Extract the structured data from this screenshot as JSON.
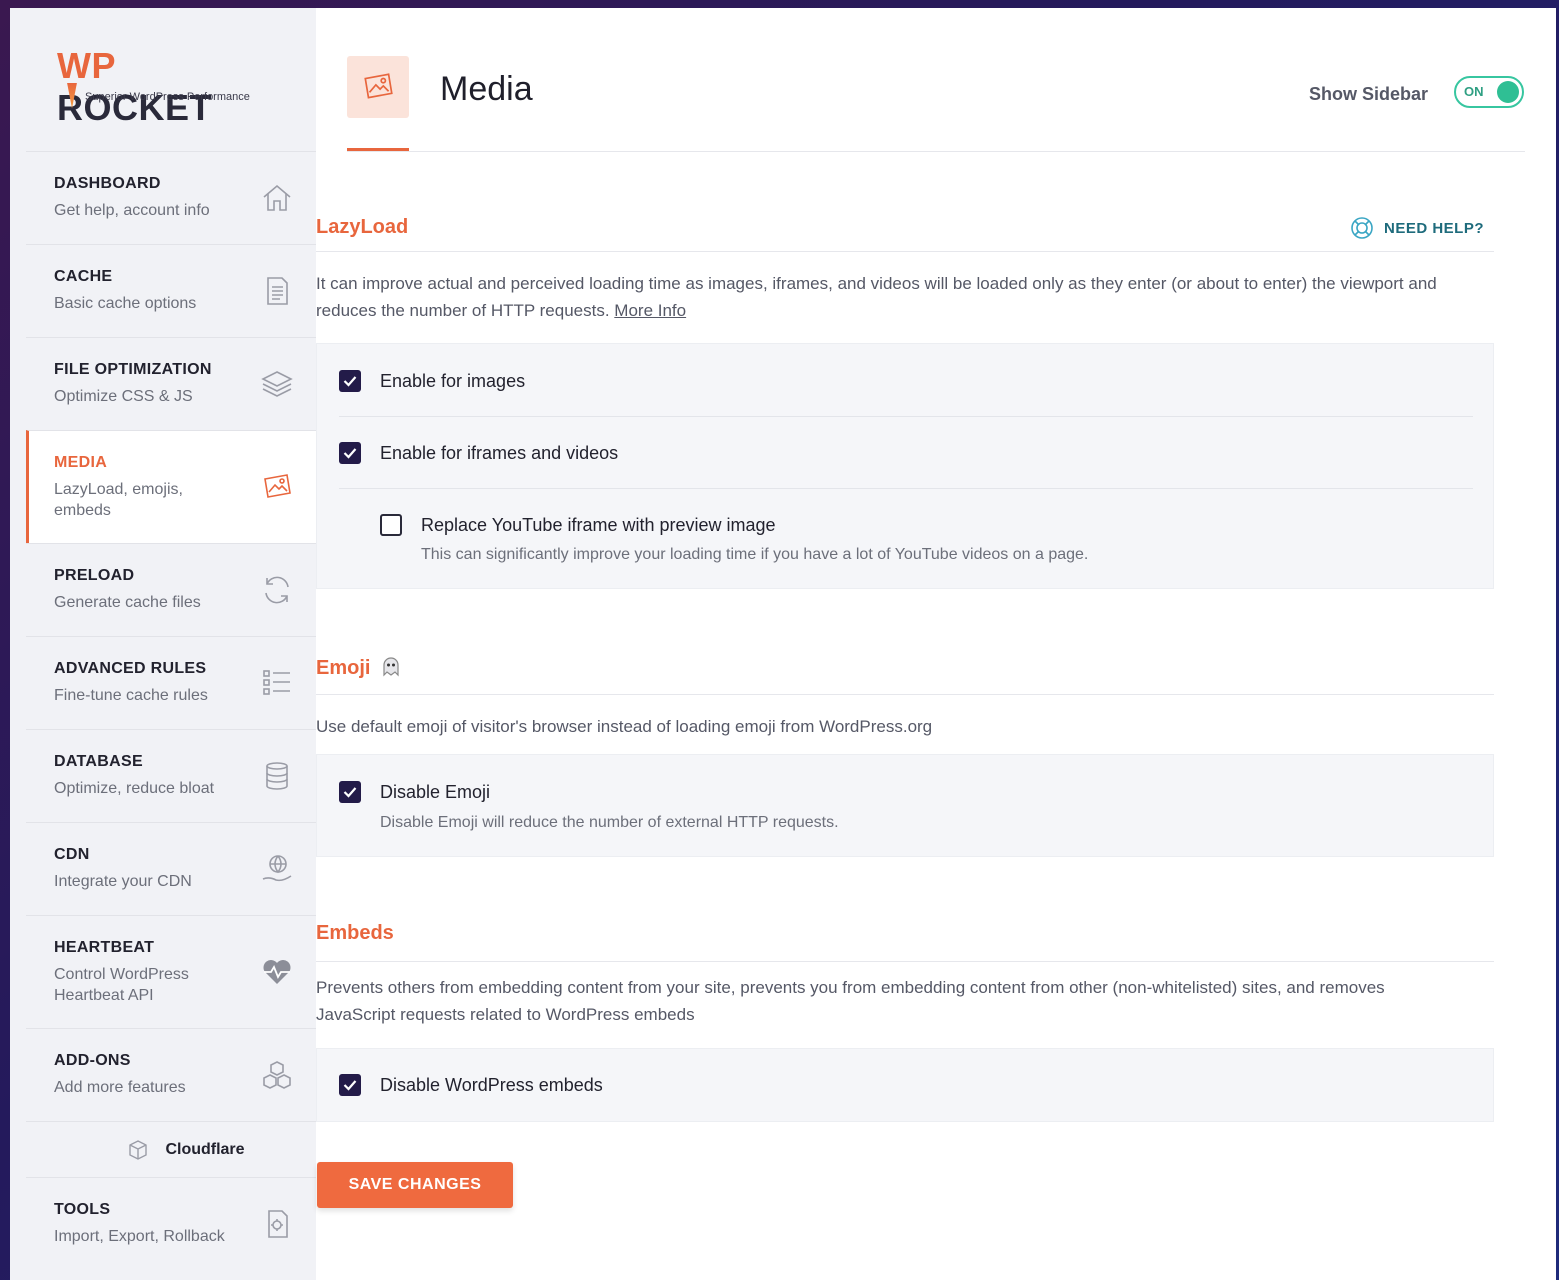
{
  "logo": {
    "brand_wp": "WP",
    "brand_rest": " ROCKET",
    "tagline": "Superior WordPress Performance"
  },
  "sidebar": {
    "items": [
      {
        "title": "DASHBOARD",
        "subtitle": "Get help, account info",
        "icon": "home-icon"
      },
      {
        "title": "CACHE",
        "subtitle": "Basic cache options",
        "icon": "file-icon"
      },
      {
        "title": "FILE OPTIMIZATION",
        "subtitle": "Optimize CSS & JS",
        "icon": "layers-icon"
      },
      {
        "title": "MEDIA",
        "subtitle": "LazyLoad, emojis, embeds",
        "icon": "image-icon",
        "active": true
      },
      {
        "title": "PRELOAD",
        "subtitle": "Generate cache files",
        "icon": "refresh-icon"
      },
      {
        "title": "ADVANCED RULES",
        "subtitle": "Fine-tune cache rules",
        "icon": "list-icon"
      },
      {
        "title": "DATABASE",
        "subtitle": "Optimize, reduce bloat",
        "icon": "database-icon"
      },
      {
        "title": "CDN",
        "subtitle": "Integrate your CDN",
        "icon": "globe-hand-icon"
      },
      {
        "title": "HEARTBEAT",
        "subtitle": "Control WordPress Heartbeat API",
        "icon": "heartbeat-icon"
      },
      {
        "title": "ADD-ONS",
        "subtitle": "Add more features",
        "icon": "cubes-icon"
      },
      {
        "title": "Cloudflare",
        "icon": "cube-icon"
      },
      {
        "title": "TOOLS",
        "subtitle": "Import, Export, Rollback",
        "icon": "tools-file-icon"
      }
    ]
  },
  "header": {
    "title": "Media",
    "show_sidebar_label": "Show Sidebar",
    "toggle_label": "ON"
  },
  "lazyload": {
    "title": "LazyLoad",
    "need_help": "NEED HELP?",
    "description": "It can improve actual and perceived loading time as images, iframes, and videos will be loaded only as they enter (or about to enter) the viewport and reduces the number of HTTP requests.",
    "more_info": "More Info",
    "options": [
      {
        "label": "Enable for images",
        "checked": true
      },
      {
        "label": "Enable for iframes and videos",
        "checked": true
      },
      {
        "label": "Replace YouTube iframe with preview image",
        "checked": false,
        "description": "This can significantly improve your loading time if you have a lot of YouTube videos on a page."
      }
    ]
  },
  "emoji": {
    "title": "Emoji",
    "description": "Use default emoji of visitor's browser instead of loading emoji from WordPress.org",
    "option": {
      "label": "Disable Emoji",
      "checked": true,
      "description": "Disable Emoji will reduce the number of external HTTP requests."
    }
  },
  "embeds": {
    "title": "Embeds",
    "description": "Prevents others from embedding content from your site, prevents you from embedding content from other (non-whitelisted) sites, and removes JavaScript requests related to WordPress embeds",
    "option": {
      "label": "Disable WordPress embeds",
      "checked": true
    }
  },
  "save_button": "SAVE CHANGES",
  "colors": {
    "accent": "#e8663d",
    "toggle": "#2fbf94",
    "checkbox": "#231b49"
  }
}
